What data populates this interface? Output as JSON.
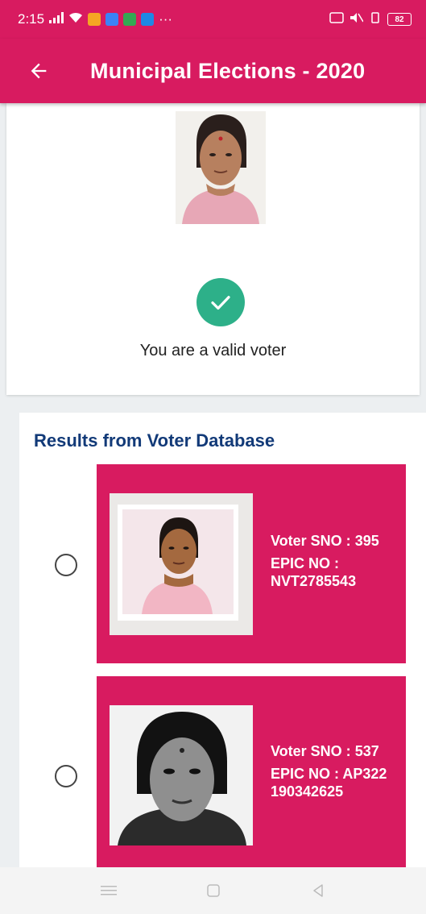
{
  "status_bar": {
    "time": "2:15",
    "right_indicators": "82",
    "more": "···"
  },
  "app_bar": {
    "title": "Municipal Elections - 2020",
    "back_icon": "arrow-left-icon"
  },
  "verification": {
    "message": "You are a valid voter",
    "status_color": "#2db089"
  },
  "results": {
    "heading": "Results from Voter Database",
    "items": [
      {
        "sno_label": "Voter SNO :",
        "sno_value": "395",
        "epic_label": "EPIC NO :",
        "epic_value": "NVT2785543",
        "selected": false
      },
      {
        "sno_label": "Voter SNO :",
        "sno_value": "537",
        "epic_label": "EPIC NO :",
        "epic_value": "AP322 190342625",
        "selected": false
      }
    ]
  },
  "colors": {
    "primary": "#d81b60",
    "heading": "#123a78",
    "success": "#2db089"
  },
  "nav_bar": {
    "icons": [
      "menu-icon",
      "home-icon",
      "back-triangle-icon"
    ]
  }
}
